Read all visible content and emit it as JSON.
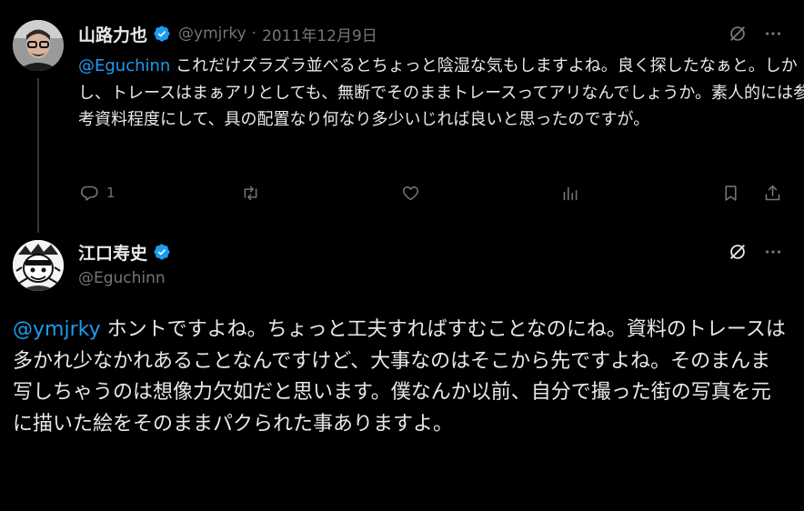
{
  "reply": {
    "author_name": "山路力也",
    "handle": "@ymjrky",
    "separator": "·",
    "date": "2011年12月9日",
    "mention": "@Eguchinn",
    "body": " これだけズラズラ並べるとちょっと陰湿な気もしますよね。良く探したなぁと。しかし、トレースはまぁアリとしても、無断でそのままトレースってアリなんでしょうか。素人的には参考資料程度にして、具の配置なり何なり多少いじれば良いと思ったのですが。",
    "reply_count": "1",
    "icons": [
      "grok-icon",
      "more-icon",
      "reply-icon",
      "retweet-icon",
      "like-icon",
      "views-icon",
      "bookmark-icon",
      "share-icon"
    ]
  },
  "main": {
    "author_name": "江口寿史",
    "handle": "@Eguchinn",
    "mention": "@ymjrky",
    "body": " ホントですよね。ちょっと工夫すればすむことなのにね。資料のトレースは多かれ少なかれあることなんですけど、大事なのはそこから先ですよね。そのまんま写しちゃうのは想像力欠如だと思います。僕なんか以前、自分で撮った街の写真を元に描いた絵をそのままパクられた事ありますよ。"
  },
  "colors": {
    "background": "#000000",
    "text": "#e7e9ea",
    "secondary": "#71767b",
    "accent": "#1d9bf0"
  }
}
